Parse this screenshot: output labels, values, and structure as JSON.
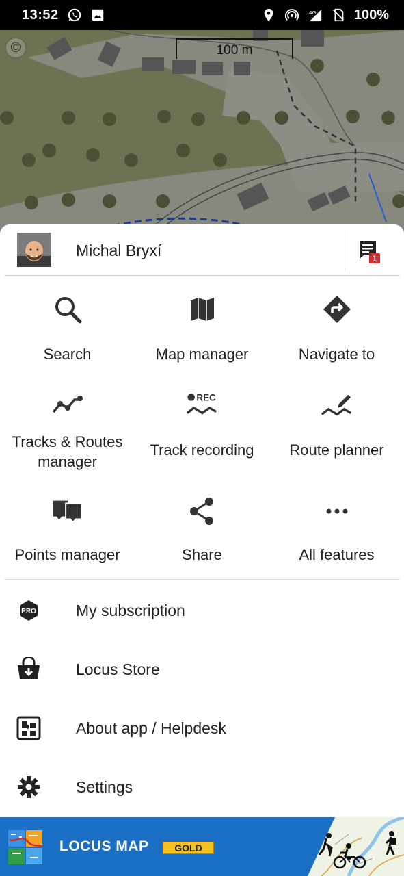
{
  "status_bar": {
    "time": "13:52",
    "battery": "100%",
    "network": "4G"
  },
  "map": {
    "copyright_symbol": "©",
    "scale_label": "100 m"
  },
  "user": {
    "name": "Michal Bryxí",
    "message_count": "1"
  },
  "grid": [
    {
      "label": "Search",
      "icon": "search-icon"
    },
    {
      "label": "Map manager",
      "icon": "map-icon"
    },
    {
      "label": "Navigate to",
      "icon": "navigate-icon"
    },
    {
      "label": "Tracks & Routes manager",
      "icon": "tracks-icon"
    },
    {
      "label": "Track recording",
      "icon": "track-recording-icon"
    },
    {
      "label": "Route planner",
      "icon": "route-planner-icon"
    },
    {
      "label": "Points manager",
      "icon": "points-icon"
    },
    {
      "label": "Share",
      "icon": "share-icon"
    },
    {
      "label": "All features",
      "icon": "more-icon"
    }
  ],
  "rec_badge": "REC",
  "list": [
    {
      "label": "My subscription",
      "icon": "pro-icon",
      "badge": "PRO"
    },
    {
      "label": "Locus Store",
      "icon": "store-icon"
    },
    {
      "label": "About app / Helpdesk",
      "icon": "helpdesk-icon"
    },
    {
      "label": "Settings",
      "icon": "gear-icon"
    }
  ],
  "banner": {
    "title": "LOCUS MAP",
    "badge": "GOLD"
  },
  "colors": {
    "map_bg": "#6e7252",
    "banner_bg": "#1a6fc4",
    "gold": "#f4c21f",
    "icon": "#333333",
    "badge_red": "#d32f2f"
  }
}
